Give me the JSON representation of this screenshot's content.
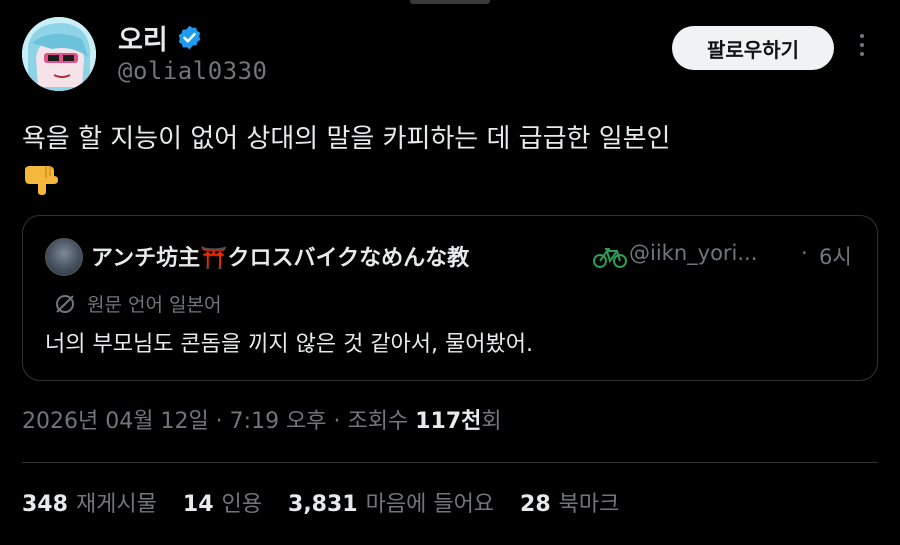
{
  "header": {
    "display_name": "오리",
    "handle": "@olial0330",
    "follow_label": "팔로우하기"
  },
  "tweet": {
    "text": "욕을 할 지능이 없어 상대의 말을 카피하는 데 급급한 일본인"
  },
  "quote": {
    "name": "アンチ坊主⛩️クロスバイクなめんな教",
    "handle": "@iikn_yori...",
    "separator": "·",
    "time": "6시",
    "lang_label": "원문 언어 일본어",
    "text": "너의 부모님도 콘돔을 끼지 않은 것 같아서, 물어봤어."
  },
  "meta": {
    "datetime": "2026년 04월 12일 · 7:19 오후 · 조회수 ",
    "views": "117천",
    "views_suffix": "회"
  },
  "stats": [
    {
      "num": "348",
      "label": "재게시물"
    },
    {
      "num": "14",
      "label": "인용"
    },
    {
      "num": "3,831",
      "label": "마음에 들어요"
    },
    {
      "num": "28",
      "label": "북마크"
    }
  ],
  "colors": {
    "background": "#000000",
    "text": "#e7e9ea",
    "muted": "#71767b",
    "verified": "#1d9bf0",
    "border": "#2f3336"
  }
}
